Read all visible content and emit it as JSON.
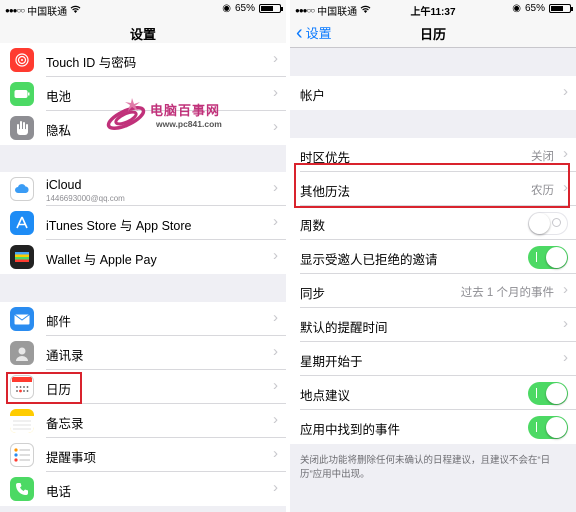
{
  "colors": {
    "accent": "#0a7aff",
    "toggle_on": "#4cd964",
    "highlight": "#d9232d",
    "bg": "#efeff4",
    "watermark": "#c0317a"
  },
  "left": {
    "status": {
      "carrier": "中国联通",
      "signal": "●●●○○",
      "battery": "65%",
      "battery_level": 0.65
    },
    "title": "设置",
    "rows": {
      "touchid": {
        "label": "Touch ID 与密码",
        "icon": "fingerprint-icon",
        "color": "#ff3b30"
      },
      "battery": {
        "label": "电池",
        "icon": "battery-icon",
        "color": "#4cd964"
      },
      "privacy": {
        "label": "隐私",
        "icon": "hand-icon",
        "color": "#8e8e93"
      },
      "icloud": {
        "label": "iCloud",
        "sub": "1446693000@qq.com",
        "icon": "cloud-icon",
        "color": "#ffffff"
      },
      "itunes": {
        "label": "iTunes Store 与 App Store",
        "icon": "app-store-icon",
        "color": "#1e8cf5"
      },
      "wallet": {
        "label": "Wallet 与 Apple Pay",
        "icon": "wallet-icon",
        "color": "#222222"
      },
      "mail": {
        "label": "邮件",
        "icon": "envelope-icon",
        "color": "#2a8cf0"
      },
      "contacts": {
        "label": "通讯录",
        "icon": "contacts-icon",
        "color": "#9b9b9b"
      },
      "calendar": {
        "label": "日历",
        "icon": "calendar-icon",
        "color": "#ffffff"
      },
      "notes": {
        "label": "备忘录",
        "icon": "notes-icon",
        "color": "#ffcc00"
      },
      "reminders": {
        "label": "提醒事项",
        "icon": "reminders-icon",
        "color": "#ffffff"
      },
      "phone": {
        "label": "电话",
        "icon": "phone-icon",
        "color": "#4cd964"
      }
    },
    "watermark": {
      "title": "电脑百事网",
      "url": "www.pc841.com"
    }
  },
  "right": {
    "status": {
      "carrier": "中国联通",
      "signal": "●●●○○",
      "time": "上午11:37",
      "battery": "65%",
      "battery_level": 0.65
    },
    "back_label": "设置",
    "title": "日历",
    "rows": {
      "accounts": {
        "label": "帐户"
      },
      "timezone": {
        "label": "时区优先",
        "value": "关闭"
      },
      "alt_calendars": {
        "label": "其他历法",
        "value": "农历"
      },
      "week_numbers": {
        "label": "周数",
        "on": false
      },
      "show_declined": {
        "label": "显示受邀人已拒绝的邀请",
        "on": true
      },
      "sync": {
        "label": "同步",
        "value": "过去 1 个月的事件"
      },
      "default_alert": {
        "label": "默认的提醒时间"
      },
      "week_start": {
        "label": "星期开始于"
      },
      "location": {
        "label": "地点建议",
        "on": true
      },
      "found_events": {
        "label": "应用中找到的事件",
        "on": true
      }
    },
    "footnote": "关闭此功能将删除任何未确认的日程建议，且建议不会在“日历”应用中出现。"
  }
}
